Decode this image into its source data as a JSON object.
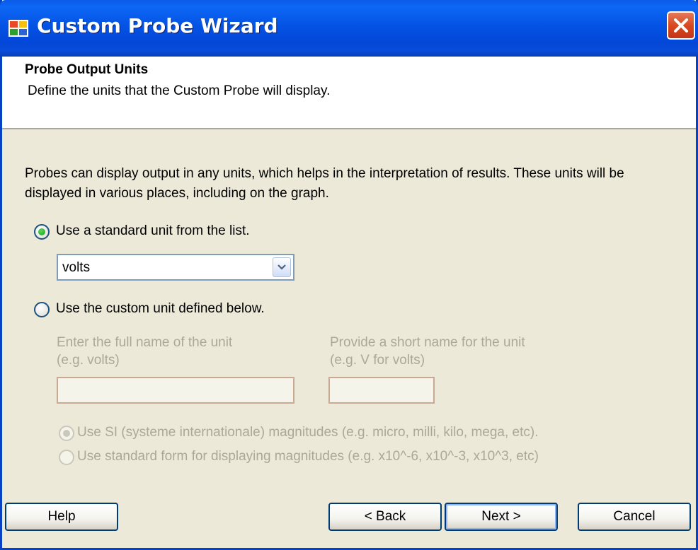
{
  "window": {
    "title": "Custom Probe Wizard",
    "app_icon": "wizard-app-icon",
    "close_icon": "close-icon"
  },
  "header": {
    "title": "Probe Output Units",
    "subtitle": "Define the units that the Custom Probe will display."
  },
  "intro_text": "Probes can display output in any units, which helps in the interpretation of results. These units will be displayed in various places, including on the graph.",
  "options": {
    "standard": {
      "label": "Use a standard unit from the list.",
      "checked": true,
      "selected_unit": "volts"
    },
    "custom": {
      "label": "Use the custom unit defined below.",
      "checked": false,
      "full_name_label_line1": "Enter the full name of the unit",
      "full_name_label_line2": "(e.g. volts)",
      "full_name_value": "",
      "short_name_label_line1": "Provide a short name for the unit",
      "short_name_label_line2": "(e.g. V for volts)",
      "short_name_value": "",
      "magnitude_si_label": "Use SI (systeme internationale) magnitudes (e.g. micro, milli, kilo, mega, etc).",
      "magnitude_standard_label": "Use standard form for displaying magnitudes (e.g. x10^-6, x10^-3, x10^3, etc)"
    }
  },
  "buttons": {
    "help": "Help",
    "back": "< Back",
    "next": "Next >",
    "cancel": "Cancel"
  },
  "colors": {
    "titlebar": "#0453E4",
    "dialog_bg": "#ECE9D8",
    "radio_checked": "#21A121",
    "disabled_text": "#ACA899"
  }
}
